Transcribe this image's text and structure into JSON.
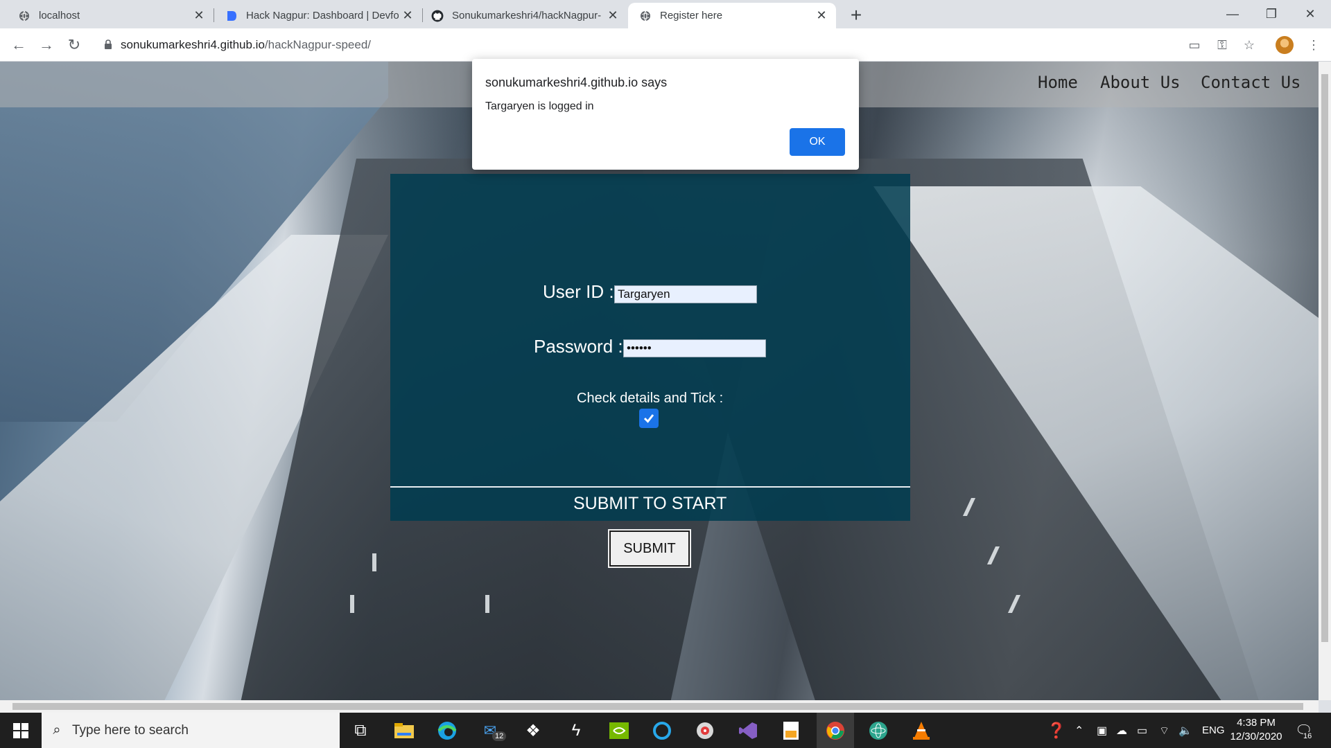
{
  "browser": {
    "tabs": [
      {
        "title": "localhost",
        "icon": "globe-icon",
        "active": false
      },
      {
        "title": "Hack Nagpur: Dashboard | Devfo",
        "icon": "devfolio-icon",
        "active": false
      },
      {
        "title": "Sonukumarkeshri4/hackNagpur-",
        "icon": "github-icon",
        "active": false
      },
      {
        "title": "Register here",
        "icon": "globe-icon",
        "active": true
      }
    ],
    "url_host": "sonukumarkeshri4.github.io",
    "url_path": "/hackNagpur-speed/"
  },
  "site": {
    "nav": [
      "Home",
      "About Us",
      "Contact Us"
    ],
    "form": {
      "userid_label": "User ID :",
      "userid_value": "Targaryen",
      "password_label": "Password :",
      "password_value": "••••••",
      "check_label": "Check details and Tick :",
      "checked": true,
      "submit_heading": "SUBMIT TO START",
      "submit_label": "SUBMIT"
    }
  },
  "alert": {
    "title": "sonukumarkeshri4.github.io says",
    "message": "Targaryen is logged in",
    "ok_label": "OK"
  },
  "taskbar": {
    "search_placeholder": "Type here to search",
    "mail_badge": "12",
    "language": "ENG",
    "time": "4:38 PM",
    "date": "12/30/2020",
    "notification_count": "16"
  },
  "colors": {
    "accent": "#1a73e8",
    "form_bg": "#003c50",
    "taskbar": "#1f1f1f"
  }
}
